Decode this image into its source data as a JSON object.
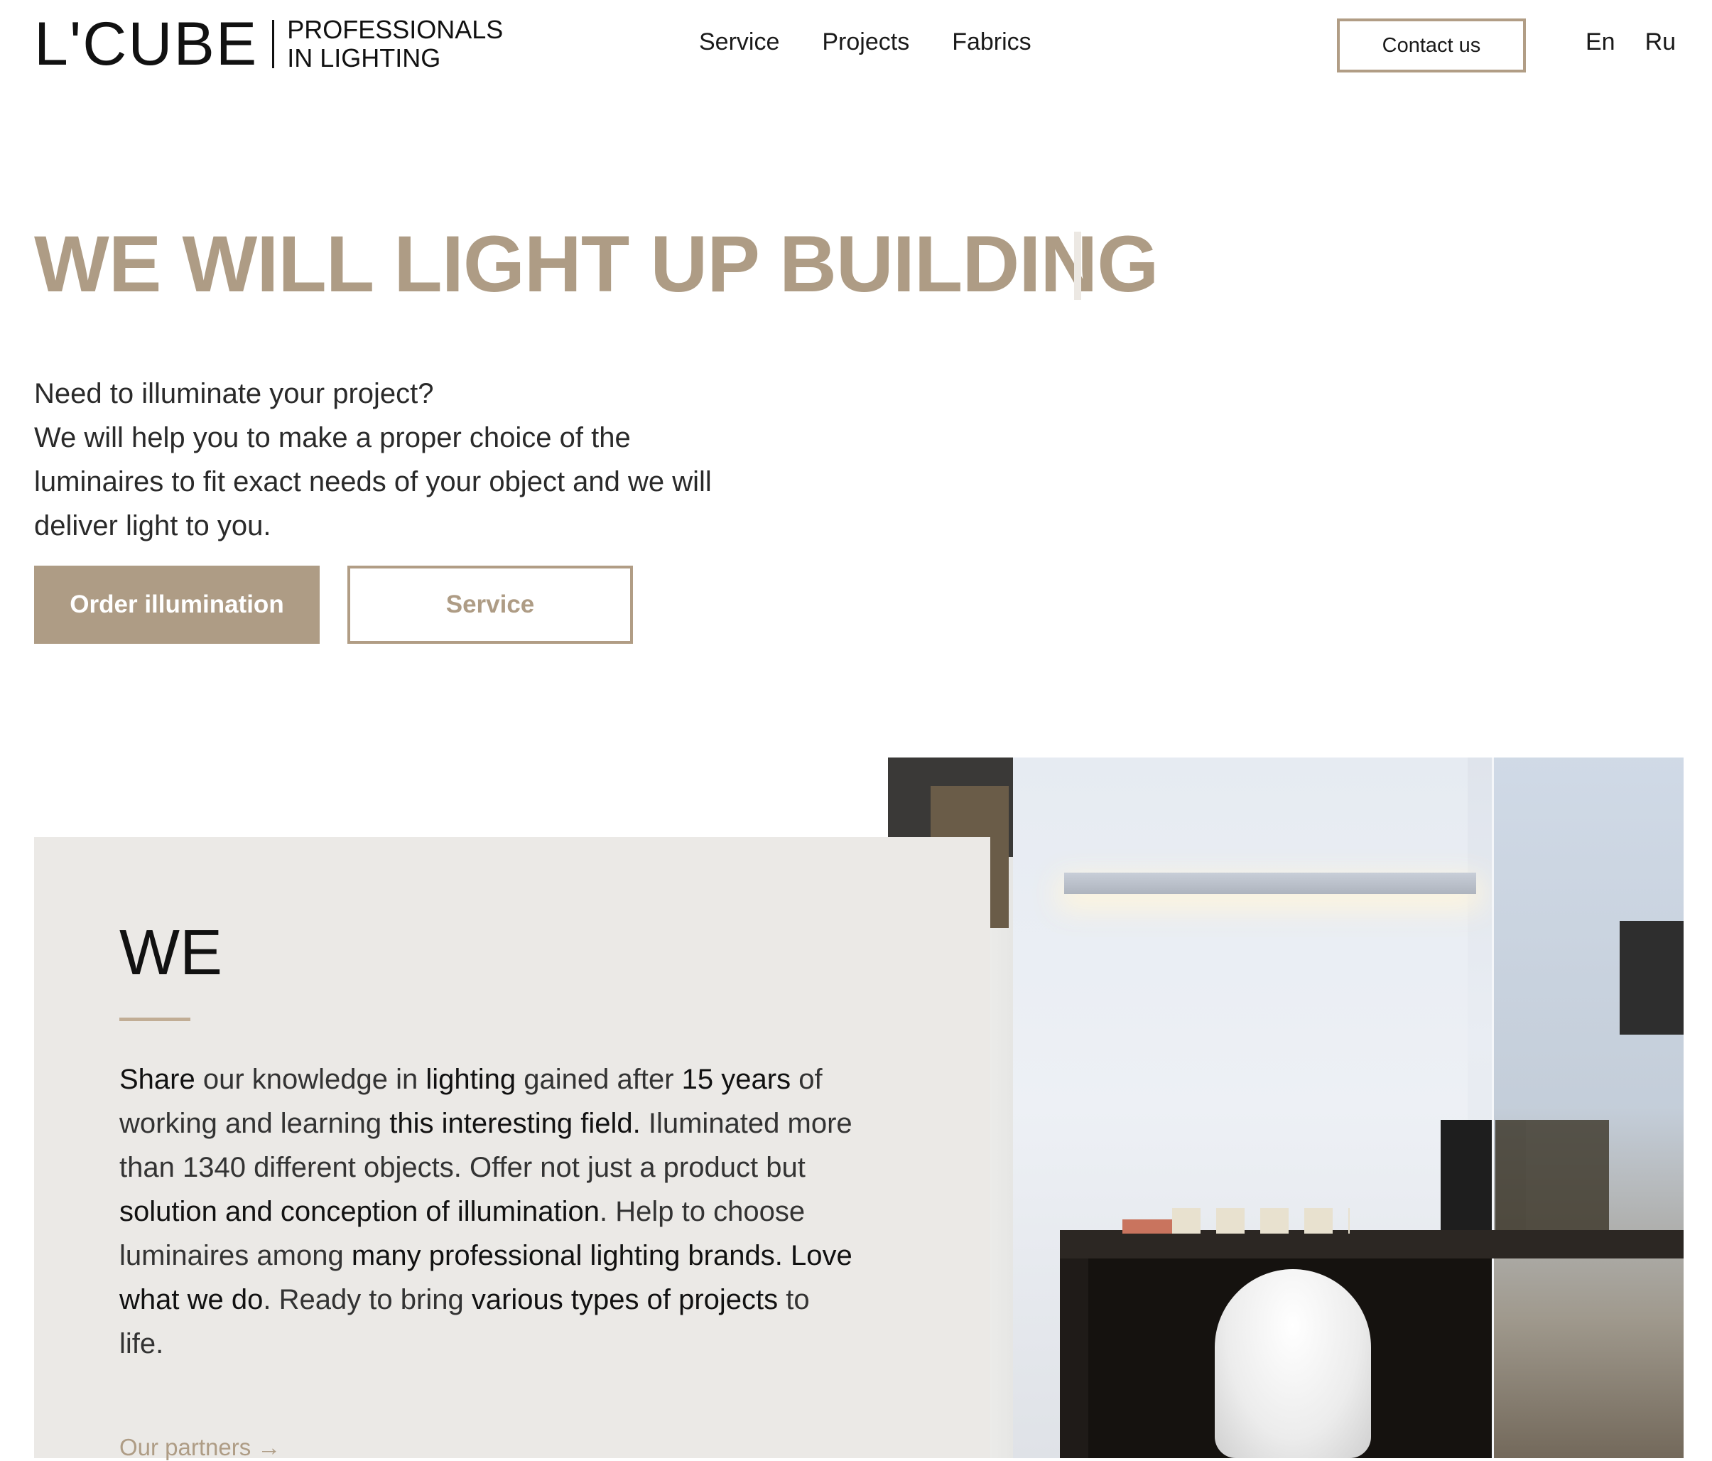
{
  "header": {
    "logo_main": "L'CUBE",
    "logo_line1": "PROFESSIONALS",
    "logo_line2": "IN LIGHTING",
    "nav": [
      "Service",
      "Projects",
      "Fabrics"
    ],
    "contact_label": "Contact us",
    "languages": [
      "En",
      "Ru"
    ]
  },
  "hero": {
    "title": "WE WILL LIGHT UP BUILDING",
    "text_lines": [
      "Need to illuminate your project?",
      "We will help you to make a proper choice of the",
      "luminaires to fit exact needs of your object and we will",
      "deliver light to you."
    ],
    "primary_button": "Order illumination",
    "secondary_button": "Service"
  },
  "about": {
    "title": "WE",
    "lines": [
      [
        {
          "t": "Share",
          "b": true
        },
        {
          "t": " our knowledge in ",
          "b": false
        },
        {
          "t": "lighting",
          "b": true
        },
        {
          "t": " gained after ",
          "b": false
        },
        {
          "t": "15 years",
          "b": true
        },
        {
          "t": " of",
          "b": false
        }
      ],
      [
        {
          "t": "working and learning ",
          "b": false
        },
        {
          "t": "this interesting field.",
          "b": true
        },
        {
          "t": " Iluminated more",
          "b": false
        }
      ],
      [
        {
          "t": "than 1340 different objects. Offer not just a product but",
          "b": false
        }
      ],
      [
        {
          "t": "solution and conception of illumination",
          "b": true
        },
        {
          "t": ". Help to choose",
          "b": false
        }
      ],
      [
        {
          "t": "luminaires among ",
          "b": false
        },
        {
          "t": "many professional lighting brands. Love",
          "b": true
        }
      ],
      [
        {
          "t": "what we do",
          "b": true
        },
        {
          "t": ". Ready to bring ",
          "b": false
        },
        {
          "t": "various types of projects",
          "b": true
        },
        {
          "t": " to",
          "b": false
        }
      ],
      [
        {
          "t": "life.",
          "b": false
        }
      ]
    ],
    "partners_link": "Our partners →"
  },
  "colors": {
    "accent": "#ae9c85",
    "card_bg": "#ebe9e6",
    "text": "#1a1a1a"
  }
}
